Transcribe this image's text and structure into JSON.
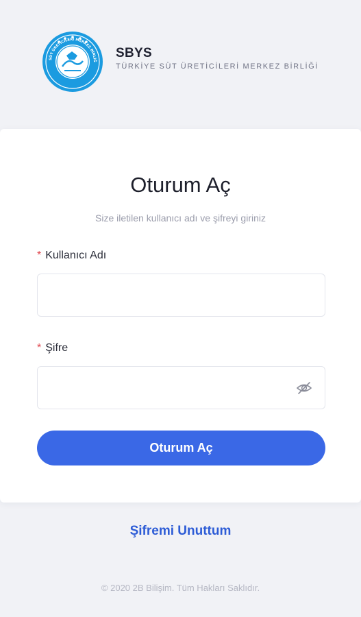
{
  "header": {
    "logo_text": "TÜRKİYE SÜT ÜRETİCİLERİ MERKEZ BİRLİĞİ TSÜMB",
    "title": "SBYS",
    "subtitle": "TÜRKİYE SÜT ÜRETİCİLERİ MERKEZ BİRLİĞİ"
  },
  "login": {
    "title": "Oturum Aç",
    "description": "Size iletilen kullanıcı adı ve şifreyi giriniz",
    "username": {
      "label": "Kullanıcı Adı",
      "required_mark": "*",
      "value": "",
      "placeholder": ""
    },
    "password": {
      "label": "Şifre",
      "required_mark": "*",
      "value": "",
      "placeholder": "",
      "toggle_icon": "eye-off-icon"
    },
    "submit_label": "Oturum Aç",
    "accent_color": "#3a68e6"
  },
  "forgot_password": "Şifremi Unuttum",
  "footer": "© 2020 2B Bilişim. Tüm Hakları Saklıdır."
}
